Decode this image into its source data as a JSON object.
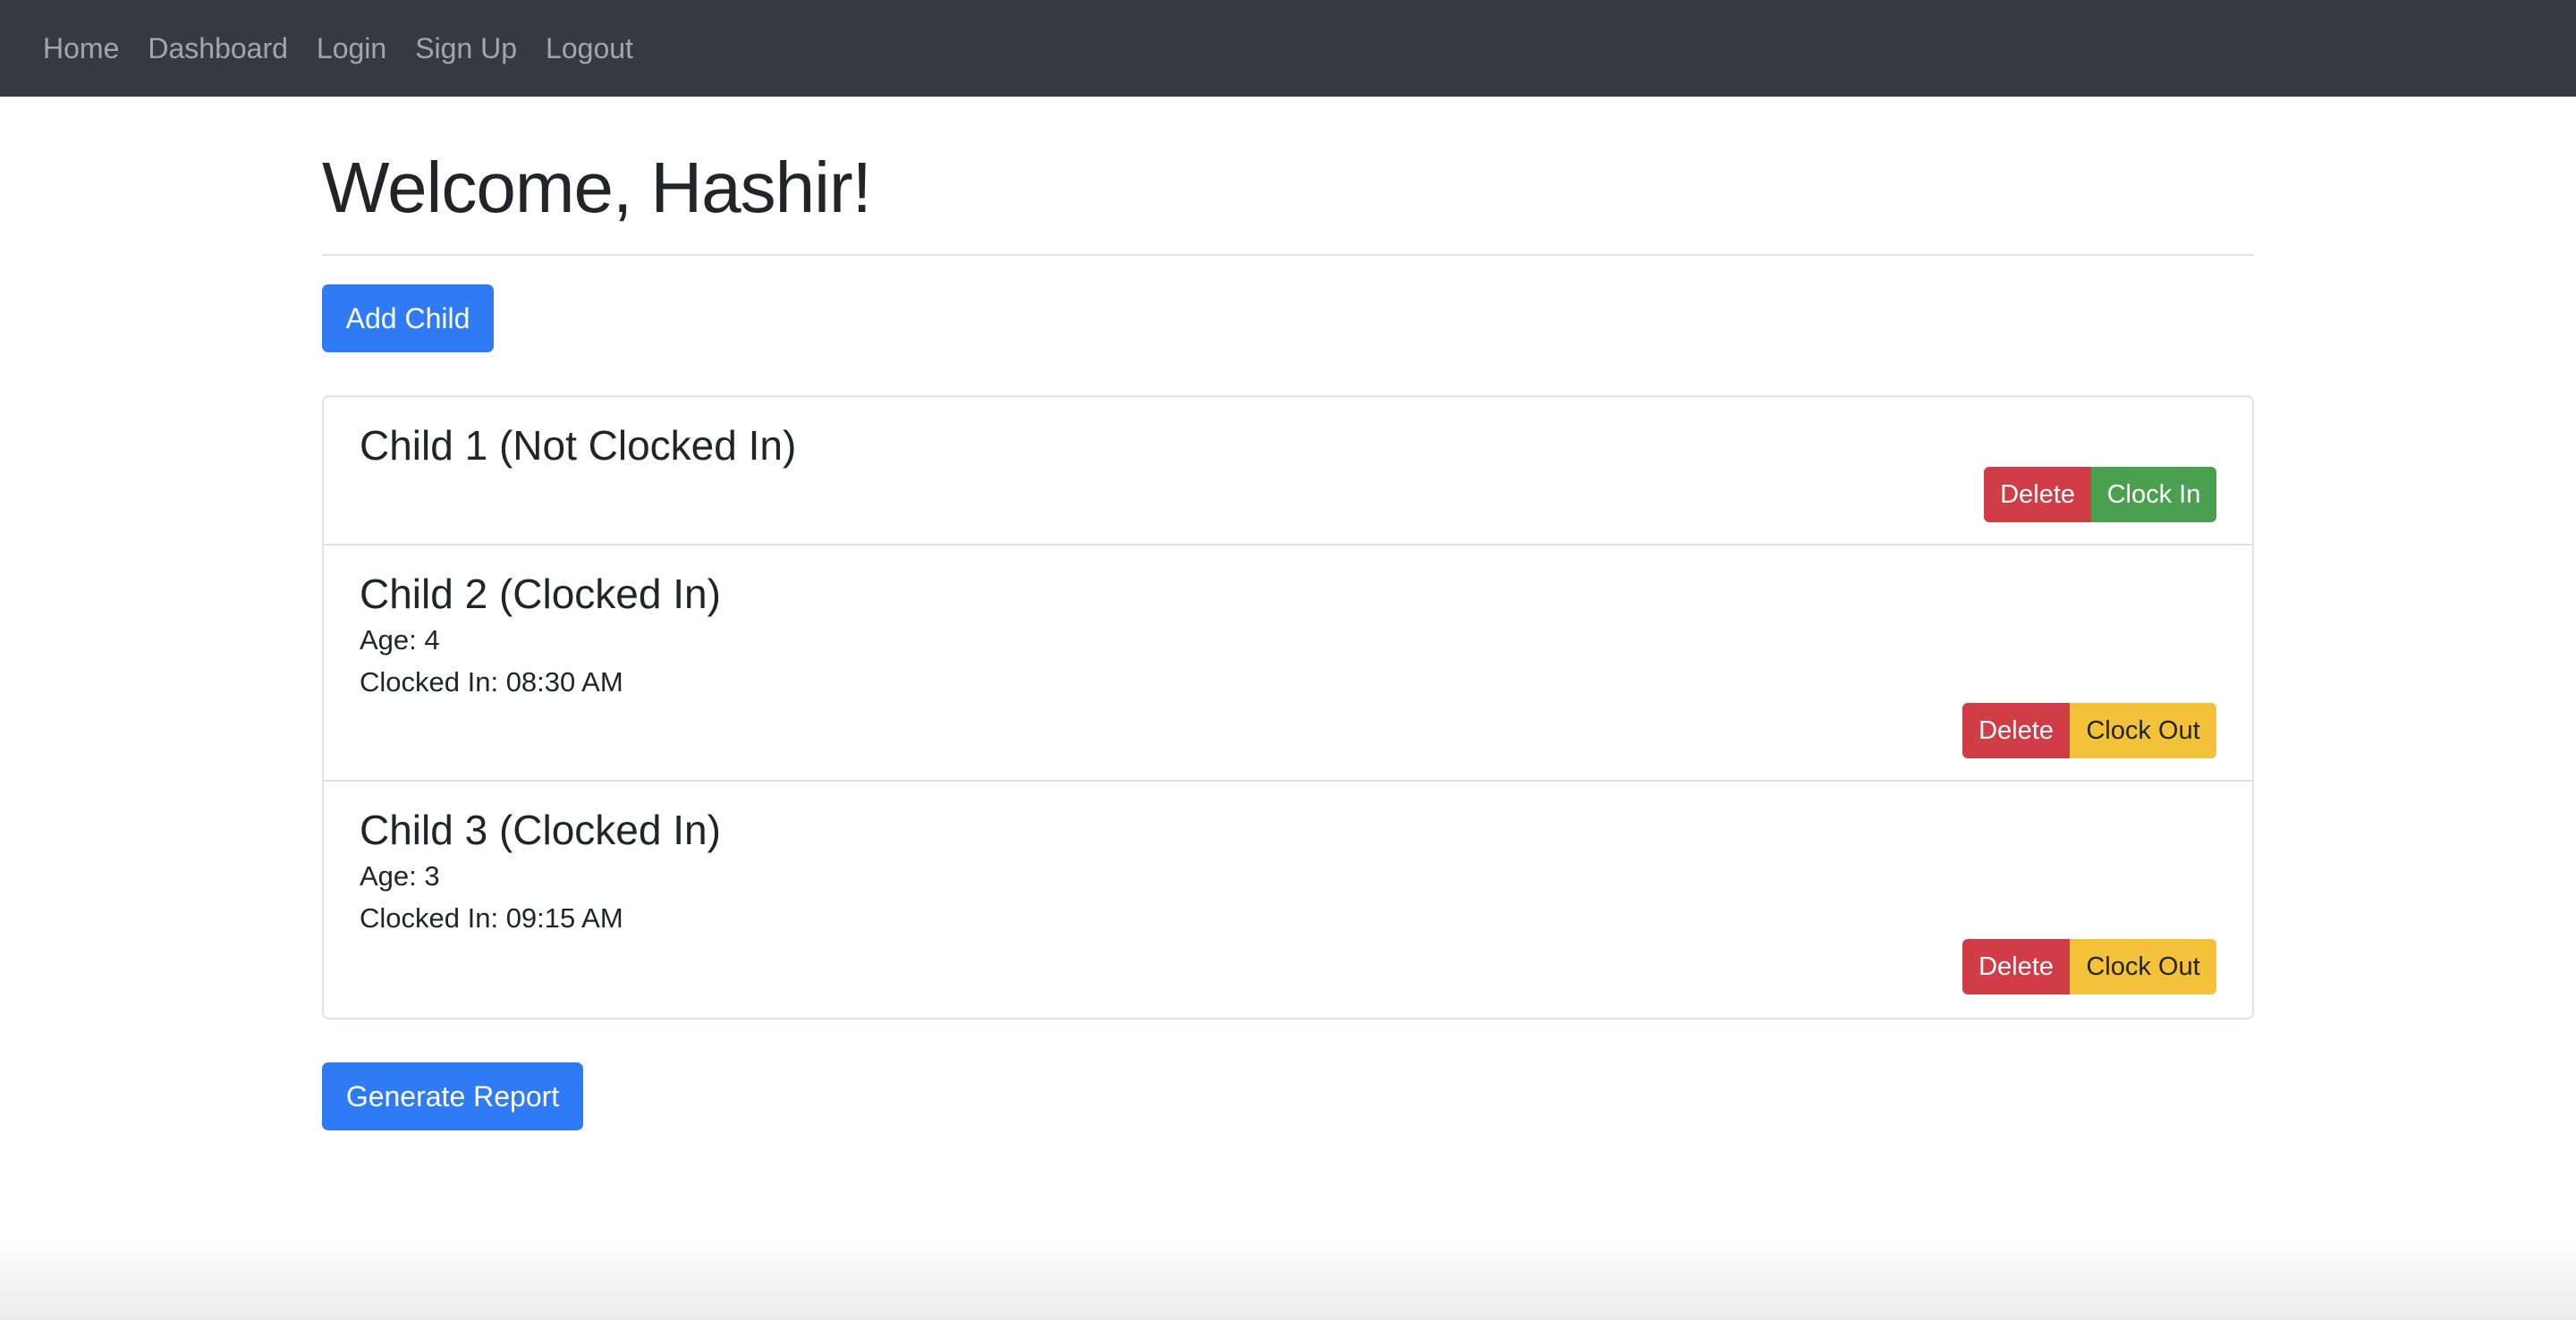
{
  "nav": {
    "links": [
      "Home",
      "Dashboard",
      "Login",
      "Sign Up",
      "Logout"
    ]
  },
  "main": {
    "welcome": "Welcome, Hashir!",
    "add_child_label": "Add Child",
    "generate_report_label": "Generate Report"
  },
  "children": [
    {
      "title": "Child 1 (Not Clocked In)",
      "delete_label": "Delete",
      "action_label": "Clock In"
    },
    {
      "title": "Child 2 (Clocked In)",
      "age": "Age: 4",
      "clocked_in": "Clocked In: 08:30 AM",
      "delete_label": "Delete",
      "action_label": "Clock Out"
    },
    {
      "title": "Child 3 (Clocked In)",
      "age": "Age: 3",
      "clocked_in": "Clocked In: 09:15 AM",
      "delete_label": "Delete",
      "action_label": "Clock Out"
    }
  ],
  "colors": {
    "navbar": "#343a40",
    "primary": "#2f7bf5",
    "danger": "#d03d47",
    "success": "#4ba04f",
    "warning": "#f3c13a"
  }
}
